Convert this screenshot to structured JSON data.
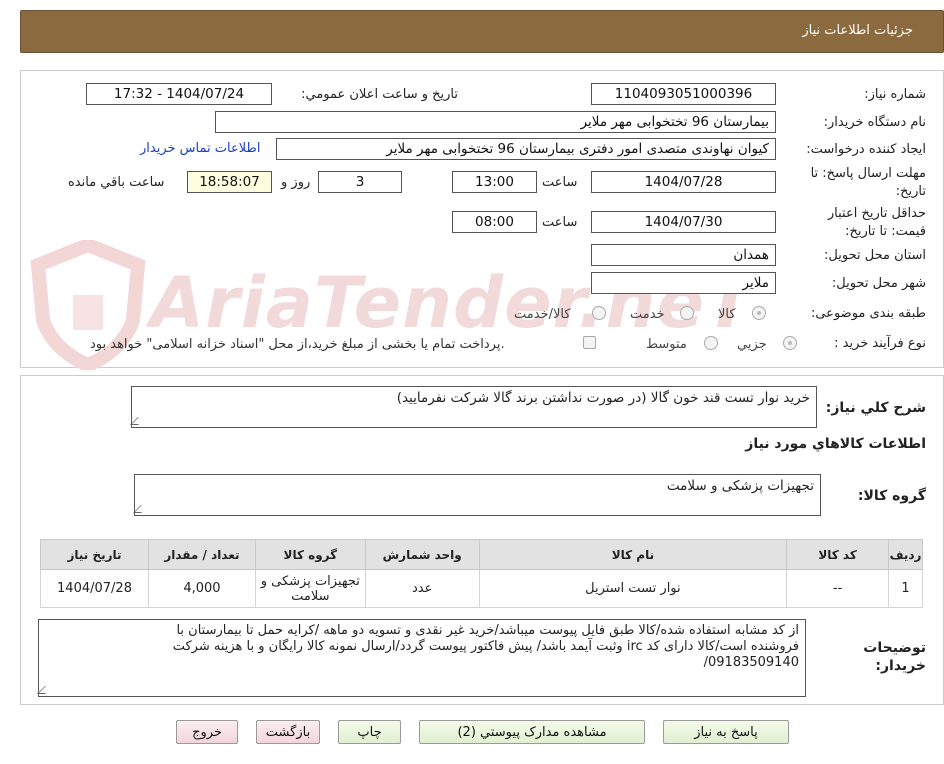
{
  "header": {
    "title": "جزئیات اطلاعات نیاز"
  },
  "watermark": "AriaTender.neT",
  "fields": {
    "need_number_label": "شماره نیاز:",
    "need_number": "1104093051000396",
    "announce_label": "تاریخ و ساعت اعلان عمومي:",
    "announce_value": "1404/07/24 - 17:32",
    "buyer_org_label": "نام دستگاه خريدار:",
    "buyer_org": "بیمارستان 96 تختخوابی مهر ملایر",
    "requester_label": "ايجاد كننده درخواست:",
    "requester": "کیوان نهاوندی متصدی امور دفتری بیمارستان 96 تختخوابی مهر ملایر",
    "contact_link": "اطلاعات تماس خريدار",
    "deadline_label_1": "مهلت ارسال پاسخ: تا",
    "deadline_label_2": "تاریخ:",
    "deadline_date": "1404/07/28",
    "time_label": "ساعت",
    "deadline_time": "13:00",
    "days_value": "3",
    "days_label": "روز و",
    "remaining_time": "18:58:07",
    "remaining_label": "ساعت باقي مانده",
    "validity_label_1": "حداقل تاريخ اعتبار",
    "validity_label_2": "قيمت: تا تاريخ:",
    "validity_date": "1404/07/30",
    "validity_time": "08:00",
    "province_label": "استان محل تحويل:",
    "province": "همدان",
    "city_label": "شهر محل تحويل:",
    "city": "ملایر",
    "category_label": "طبقه بندی موضوعی:",
    "category_options": [
      "کالا",
      "خدمت",
      "کالا/خدمت"
    ],
    "process_label": "نوع فرآيند خريد :",
    "process_options": [
      "جزيي",
      "متوسط"
    ],
    "payment_note": "پرداخت تمام يا بخشی از مبلغ خريد،از محل \"اسناد خزانه اسلامی\" خواهد بود."
  },
  "summary": {
    "label": "شرح كلي نياز:",
    "value": "خرید نوار تست قند خون گالا (در صورت نداشتن برند گالا شرکت نفرمایید)"
  },
  "goods_section_title": "اطلاعات كالاهاي مورد نياز",
  "goods_group": {
    "label": "گروه كالا:",
    "value": "تجهیزات پزشکی و سلامت"
  },
  "table": {
    "headers": [
      "ردیف",
      "کد کالا",
      "نام کالا",
      "واحد شمارش",
      "گروه کالا",
      "تعداد / مقدار",
      "تاریخ نیاز"
    ],
    "rows": [
      [
        "1",
        "--",
        "نوار تست استریل",
        "عدد",
        "تجهیزات پزشکی و سلامت",
        "4,000",
        "1404/07/28"
      ]
    ]
  },
  "buyer_notes": {
    "label_1": "توضیحات",
    "label_2": "خريدار:",
    "line1": "از کد مشابه استفاده شده/کالا طبق فایل پیوست  میباشد/خرید غیر نقدی و تسویه دو ماهه  /کرایه حمل تا بیمارستان با",
    "line2": "فروشنده است/کالا دارای کد irc  وثبت آیمد باشد/ پیش فاکتور پیوست گردد/ارسال نمونه کالا رایگان و با هزینه شرکت",
    "line3": "09183509140/"
  },
  "buttons": {
    "reply": "پاسخ به نياز",
    "attachments": "مشاهده مدارک پیوستي (2)",
    "print": "چاپ",
    "back": "بازگشت",
    "exit": "خروج"
  }
}
